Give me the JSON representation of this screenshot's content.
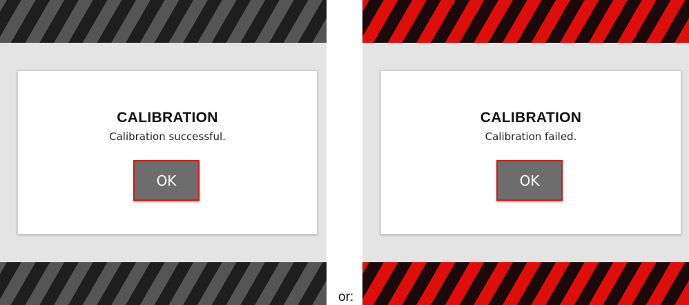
{
  "colors": {
    "stripe_gray": "#555555",
    "stripe_dark": "#1e1e1e",
    "stripe_red": "#e00d0d",
    "panel_background": "#e4e4e4",
    "button_background": "#6d6d6d",
    "button_border": "#d41a1a"
  },
  "success_screen": {
    "title": "CALIBRATION",
    "message": "Calibration successful.",
    "ok_label": "OK",
    "stripe_style": "gray-black hazard stripes"
  },
  "failure_screen": {
    "title": "CALIBRATION",
    "message": "Calibration failed.",
    "ok_label": "OK",
    "stripe_style": "red-black hazard stripes"
  },
  "separator": "or:"
}
